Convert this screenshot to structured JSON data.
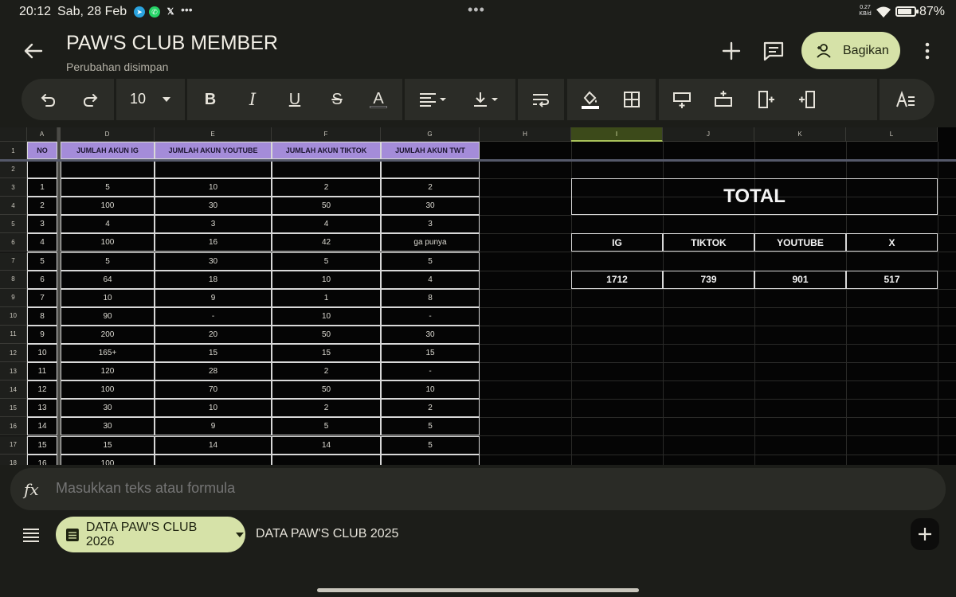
{
  "status_bar": {
    "time": "20:12",
    "date": "Sab, 28 Feb",
    "network_speed": "0.27 KB/d",
    "battery": "87%",
    "battery_level": 0.87
  },
  "header": {
    "title": "PAW'S CLUB MEMBER",
    "subtitle": "Perubahan disimpan",
    "share_label": "Bagikan"
  },
  "toolbar": {
    "font_size": "10"
  },
  "columns": {
    "A": "A",
    "D": "D",
    "E": "E",
    "F": "F",
    "G": "G",
    "H": "H",
    "I": "I",
    "J": "J",
    "K": "K",
    "L": "L"
  },
  "table": {
    "headers": [
      "NO",
      "JUMLAH AKUN IG",
      "JUMLAH AKUN YOUTUBE",
      "JUMLAH AKUN TIKTOK",
      "JUMLAH AKUN TWT"
    ],
    "row_numbers": [
      "1",
      "2",
      "3",
      "4",
      "5",
      "6",
      "7",
      "8",
      "9",
      "10",
      "11",
      "12",
      "13",
      "14",
      "15",
      "16",
      "17",
      "18"
    ],
    "rows": [
      [
        "1",
        "5",
        "10",
        "2",
        "2"
      ],
      [
        "2",
        "100",
        "30",
        "50",
        "30"
      ],
      [
        "3",
        "4",
        "3",
        "4",
        "3"
      ],
      [
        "4",
        "100",
        "16",
        "42",
        "ga punya"
      ],
      [
        "5",
        "5",
        "30",
        "5",
        "5"
      ],
      [
        "6",
        "64",
        "18",
        "10",
        "4"
      ],
      [
        "7",
        "10",
        "9",
        "1",
        "8"
      ],
      [
        "8",
        "90",
        "-",
        "10",
        "-"
      ],
      [
        "9",
        "200",
        "20",
        "50",
        "30"
      ],
      [
        "10",
        "165+",
        "15",
        "15",
        "15"
      ],
      [
        "11",
        "120",
        "28",
        "2",
        "-"
      ],
      [
        "12",
        "100",
        "70",
        "50",
        "10"
      ],
      [
        "13",
        "30",
        "10",
        "2",
        "2"
      ],
      [
        "14",
        "30",
        "9",
        "5",
        "5"
      ],
      [
        "15",
        "15",
        "14",
        "14",
        "5"
      ],
      [
        "16",
        "100",
        "",
        "",
        ""
      ]
    ]
  },
  "totals": {
    "title": "TOTAL",
    "labels": [
      "IG",
      "TIKTOK",
      "YOUTUBE",
      "X"
    ],
    "values": [
      "1712",
      "739",
      "901",
      "517"
    ]
  },
  "formula_bar": {
    "fx_label": "fx",
    "placeholder": "Masukkan teks atau formula"
  },
  "sheets": {
    "active": "DATA PAW'S CLUB 2026",
    "other": "DATA PAW'S CLUB 2025"
  }
}
